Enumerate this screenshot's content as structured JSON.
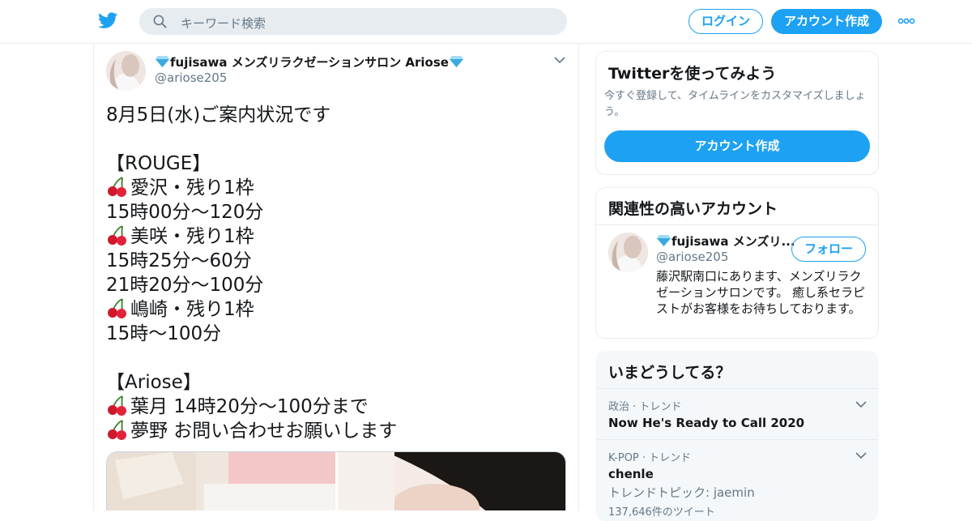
{
  "header": {
    "search_placeholder": "キーワード検索",
    "login_label": "ログイン",
    "signup_label": "アカウント作成"
  },
  "tweet": {
    "display_name": "fujisawa メンズリラクゼーションサロン Ariose",
    "handle": "@ariose205",
    "lines": [
      "8月5日(水)ご案内状況です",
      "",
      "【ROUGE】",
      "愛沢・残り1枠",
      "15時00分～120分",
      "美咲・残り1枠",
      "15時25分～60分",
      "21時20分～100分",
      "嶋崎・残り1枠",
      "15時～100分",
      "",
      "【Ariose】",
      "葉月 14時20分～100分まで",
      "夢野 お問い合わせお願いします"
    ]
  },
  "signup_card": {
    "title": "Twitterを使ってみよう",
    "subtitle": "今すぐ登録して、タイムラインをカスタマイズしましょう。",
    "button_label": "アカウント作成"
  },
  "related_card": {
    "title": "関連性の高いアカウント",
    "name": "fujisawa メンズリ...",
    "handle": "@ariose205",
    "follow_label": "フォロー",
    "bio": "藤沢駅南口にあります、メンズリラクゼーションサロンです。 癒し系セラピストがお客様をお待ちしております。"
  },
  "trends_card": {
    "title": "いまどうしてる？",
    "trends": [
      {
        "context": "政治 · トレンド",
        "name": "Now He's Ready to Call 2020"
      },
      {
        "context": "K-POP · トレンド",
        "name": "chenle",
        "extra": "トレンドトピック: jaemin",
        "count": "137,646件のツイート"
      }
    ]
  },
  "colors": {
    "accent": "#1da1f2",
    "text": "#14171a",
    "secondary_text": "#657786",
    "border": "#e6ecf0",
    "search_bg": "#e6ecf0",
    "trends_bg": "#f5f8fa"
  },
  "icons": {
    "logo": "twitter-bird-icon",
    "search": "search-icon",
    "more": "more-icon",
    "caret": "chevron-down-icon",
    "bullet": "cherry-icon",
    "verified_gem": "gem-icon"
  }
}
